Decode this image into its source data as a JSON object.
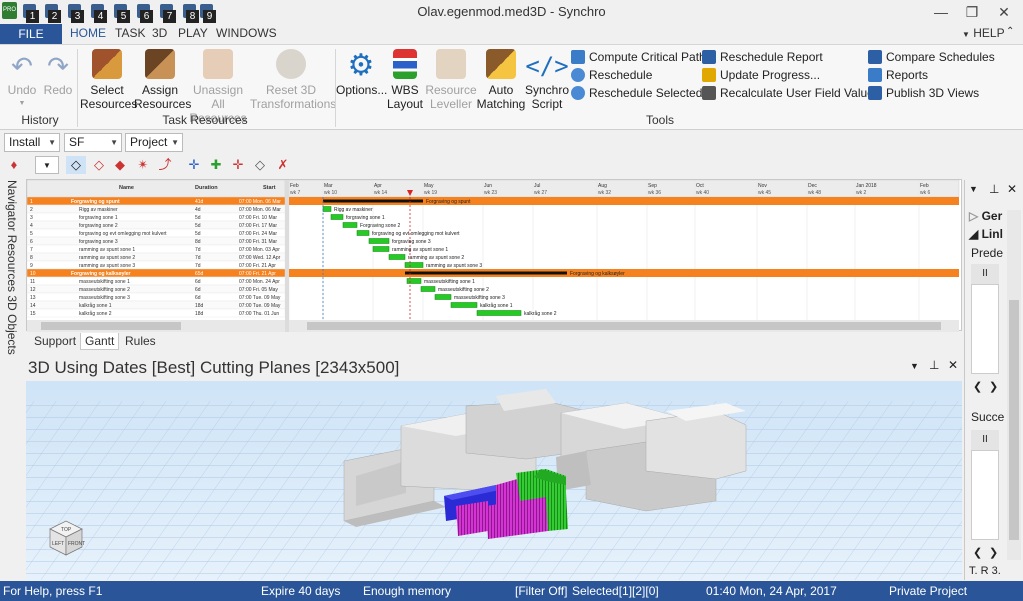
{
  "window": {
    "title": "Olav.egenmod.med3D - Synchro",
    "help_label": "HELP"
  },
  "quick_access": {
    "app_badge": "PRO",
    "numbers": [
      "1",
      "2",
      "3",
      "4",
      "5",
      "6",
      "7",
      "8",
      "9"
    ]
  },
  "tabs": [
    {
      "label": "FILE"
    },
    {
      "label": "HOME"
    },
    {
      "label": "TASK"
    },
    {
      "label": "3D"
    },
    {
      "label": "PLAY"
    },
    {
      "label": "WINDOWS"
    }
  ],
  "ribbon": {
    "history": {
      "group_label": "History",
      "undo": "Undo",
      "redo": "Redo"
    },
    "task_resources": {
      "group_label": "Task Resources",
      "select_l1": "Select",
      "select_l2": "Resources",
      "assign_l1": "Assign",
      "assign_l2": "Resources",
      "unassign_l1": "Unassign All",
      "unassign_l2": "Resources",
      "reset_l1": "Reset 3D",
      "reset_l2": "Transformations"
    },
    "tools": {
      "group_label": "Tools",
      "options": "Options...",
      "wbs_l1": "WBS",
      "wbs_l2": "Layout",
      "leveller_l1": "Resource",
      "leveller_l2": "Leveller",
      "automatch_l1": "Auto",
      "automatch_l2": "Matching",
      "script_l1": "Synchro",
      "script_l2": "Script",
      "compute_critical_path": "Compute Critical Path",
      "reschedule": "Reschedule",
      "reschedule_selected": "Reschedule Selected",
      "reschedule_report": "Reschedule Report",
      "update_progress": "Update Progress...",
      "recalculate": "Recalculate User Field Values",
      "compare_schedules": "Compare Schedules",
      "reports": "Reports",
      "publish_3d": "Publish 3D Views"
    }
  },
  "filters": {
    "filter1": "Install",
    "filter2": "SF",
    "filter3": "Project"
  },
  "side_nav": {
    "label": "Navigator  Resources  3D Objects"
  },
  "gantt": {
    "columns": [
      "Name",
      "Duration",
      "Start"
    ],
    "rows": [
      {
        "id": "1",
        "name": "Forgraving og spunt",
        "duration": "41d",
        "start": "07:00 Mon. 06 Mar",
        "summary": true
      },
      {
        "id": "2",
        "name": "Rigg av maskiner",
        "duration": "4d",
        "start": "07:00 Mon. 06 Mar",
        "summary": false
      },
      {
        "id": "3",
        "name": "forgraving sone 1",
        "duration": "5d",
        "start": "07:00 Fri. 10 Mar",
        "summary": false
      },
      {
        "id": "4",
        "name": "forgraving sone 2",
        "duration": "5d",
        "start": "07:00 Fri. 17 Mar",
        "summary": false
      },
      {
        "id": "5",
        "name": "forgraving og evt omlegging mot kulvert",
        "duration": "5d",
        "start": "07:00 Fri. 24 Mar",
        "summary": false
      },
      {
        "id": "6",
        "name": "forgraving sone 3",
        "duration": "8d",
        "start": "07:00 Fri. 31 Mar",
        "summary": false
      },
      {
        "id": "7",
        "name": "ramming av spunt sone 1",
        "duration": "7d",
        "start": "07:00 Mon. 03 Apr",
        "summary": false
      },
      {
        "id": "8",
        "name": "ramming av spunt sone 2",
        "duration": "7d",
        "start": "07:00 Wed. 12 Apr",
        "summary": false
      },
      {
        "id": "9",
        "name": "ramming av spunt sone 3",
        "duration": "7d",
        "start": "07:00 Fri. 21 Apr",
        "summary": false
      },
      {
        "id": "10",
        "name": "Forgraving og kalksøyler",
        "duration": "65d",
        "start": "07:00 Fri. 21 Apr",
        "summary": true
      },
      {
        "id": "11",
        "name": "masseutskifting sone 1",
        "duration": "6d",
        "start": "07:00 Mon. 24 Apr",
        "summary": false
      },
      {
        "id": "12",
        "name": "masseutskifting sone 2",
        "duration": "6d",
        "start": "07:00 Fri. 05 May",
        "summary": false
      },
      {
        "id": "13",
        "name": "masseutskifting sone 3",
        "duration": "6d",
        "start": "07:00 Tue. 09 May",
        "summary": false
      },
      {
        "id": "14",
        "name": "kalkråg sone 1",
        "duration": "18d",
        "start": "07:00 Tue. 09 May",
        "summary": false
      },
      {
        "id": "15",
        "name": "kalkråg sone 2",
        "duration": "18d",
        "start": "07:00 Thu. 01 Jun",
        "summary": false
      }
    ],
    "bar_labels": [
      "Forgraving og spunt",
      "Rigg av maskiner",
      "forgraving sone 1",
      "Forgraving sone 2",
      "forgraving og evt omlegging mot kulvert",
      "forgraving sone 3",
      "ramming av spunt sone 1",
      "ramming av spunt sone 2",
      "ramming av spunt sone 3",
      "Forgraving og kalksøyler",
      "masseutskifting sone 1",
      "masseutskifting sone 2",
      "masseutskifting sone 3",
      "kalkråg sone 1",
      "kalkråg sone 2"
    ],
    "months": [
      "Feb",
      "Mar",
      "Apr",
      "May",
      "Jun",
      "Jul",
      "Aug",
      "Sep",
      "Oct",
      "Nov",
      "Dec",
      "Jan 2018",
      "Feb"
    ],
    "weeks": [
      "wk 7",
      "wk 10",
      "wk 14",
      "wk 19",
      "wk 23",
      "wk 27",
      "wk 32",
      "wk 36",
      "wk 40",
      "wk 45",
      "wk 48",
      "wk 2",
      "wk 6"
    ],
    "bottom_tabs": [
      "Support",
      "Gantt",
      "Rules"
    ]
  },
  "view3d": {
    "title": "3D Using Dates [Best] Cutting Planes [2343x500]",
    "cube_labels": [
      "TOP",
      "LEFT",
      "FRONT"
    ]
  },
  "right_panel": {
    "general": "Ger",
    "links": "Linl",
    "predecessors": "Prede",
    "successors": "Succe",
    "tabs": "T. R 3."
  },
  "status": {
    "help": "For Help, press F1",
    "expire": "Expire 40 days",
    "memory": "Enough memory",
    "filter": "[Filter Off]",
    "selected": "Selected[1][2][0]",
    "datetime": "01:40 Mon, 24 Apr, 2017",
    "project": "Private Project"
  },
  "colors": {
    "accent": "#2a5699",
    "summary_row": "#f5821f",
    "task_bar": "#22cc22",
    "magenta": "#cc22cc",
    "blue_obj": "#2222cc"
  }
}
